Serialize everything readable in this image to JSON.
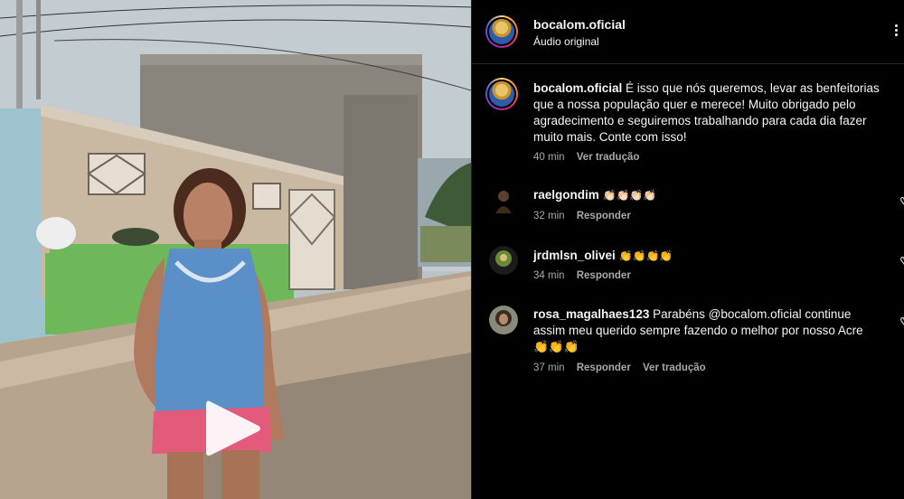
{
  "post": {
    "author": "bocalom.oficial",
    "audio": "Áudio original"
  },
  "caption": {
    "user": "bocalom.oficial",
    "text": "É isso que nós queremos, levar as benfeitorias que a nossa população quer e merece! Muito obrigado pelo agradecimento e seguiremos trabalhando para cada dia fazer muito mais. Conte com isso!",
    "time": "40 min",
    "translate": "Ver tradução"
  },
  "comments": [
    {
      "user": "raelgondim",
      "text": "👏🏻👏🏻👏🏻👏🏻",
      "time": "32 min",
      "reply": "Responder",
      "avatar_color": "#3b2a20"
    },
    {
      "user": "jrdmlsn_olivei",
      "text": "👏👏👏👏",
      "time": "34 min",
      "reply": "Responder",
      "avatar_color": "#4a6a2a"
    },
    {
      "user": "rosa_magalhaes123",
      "text": "Parabéns @bocalom.oficial continue assim meu querido sempre fazendo o melhor por nosso Acre 👏👏👏",
      "time": "37 min",
      "reply": "Responder",
      "translate": "Ver tradução",
      "avatar_color": "#6b5a48"
    }
  ],
  "icons": {
    "play": "play-icon",
    "more": "more-options-icon",
    "like": "heart-icon"
  }
}
